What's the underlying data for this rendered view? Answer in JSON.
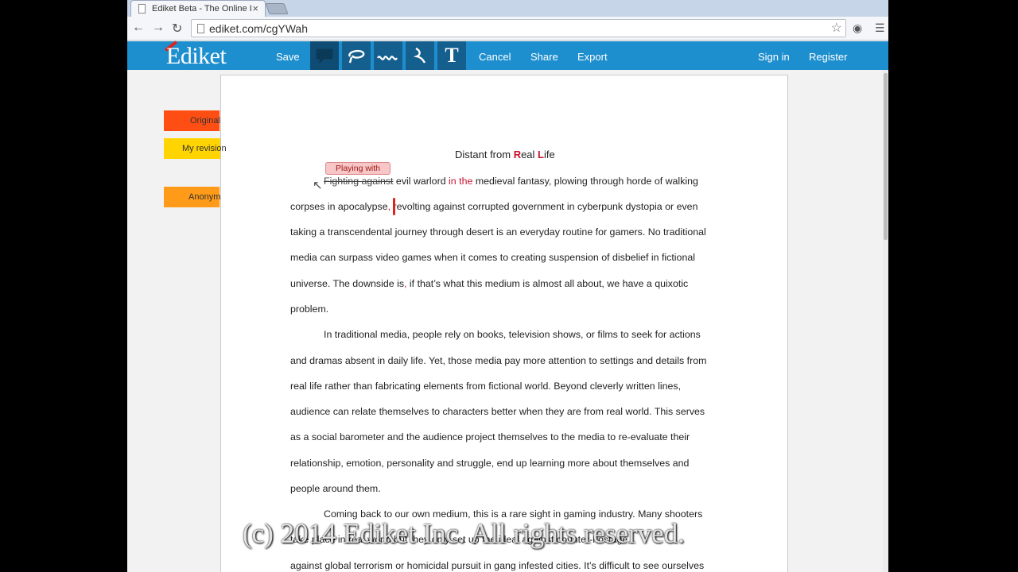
{
  "browser": {
    "tab_title": "Ediket Beta - The Online I",
    "tab_close": "×",
    "url": "ediket.com/cgYWah"
  },
  "app": {
    "logo": "Ediket",
    "nav": {
      "save": "Save",
      "cancel": "Cancel",
      "share": "Share",
      "export": "Export",
      "sign_in": "Sign in",
      "register": "Register"
    },
    "tools": [
      "comment-icon",
      "lasso-icon",
      "squiggle-icon",
      "insert-icon",
      "text-icon"
    ],
    "tool_text_label": "T"
  },
  "revisions": {
    "original": "Original",
    "mine": "My revision",
    "anonymous": "Anonym"
  },
  "document": {
    "title_prefix": "Distant from ",
    "title_R": "R",
    "title_mid": "eal ",
    "title_L": "L",
    "title_end": "ife",
    "comment": "Playing with",
    "l1_del": "Fighting against",
    "l1_a": " evil warlord ",
    "l1_ins_in": "in",
    "l1_b": " ",
    "l1_ins_the": "the",
    "l1_c": " medieval fantasy, plowing through horde of walking",
    "l2_a": "corpses in apocalypse",
    "l2_ins": ",",
    "l2_b": " revolting against corrupted government in cyberpunk dystopia or even",
    "l3": "taking a transcendental journey through desert is an everyday routine for gamers. No traditional",
    "l4": "media can surpass video games when it comes to creating suspension of disbelief in fictional",
    "l5_a": "universe. The downside is",
    "l5_ins": ",",
    "l5_b": " if that’s what this medium is almost all about, we have a quixotic",
    "l6": "problem.",
    "l7": "In traditional media, people rely on books, television shows, or films to seek for actions",
    "l8": "and dramas absent in daily life. Yet, those media pay more attention to settings and details from",
    "l9": "real life rather than fabricating elements from fictional world. Beyond cleverly written lines,",
    "l10": "audience can relate themselves to characters better when they are from real world. This serves",
    "l11": "as a social barometer and the audience project themselves to the media to re-evaluate their",
    "l12": "relationship, emotion, personality and struggle, end up learning more about themselves and",
    "l13": "people around them.",
    "l14": "Coming back to our own medium, this is a rare sight in gaming industry. Many shooters",
    "l15": "take place in real world but they only set up the ideal against counter-hostage,",
    "l16": "against global terrorism or homicidal pursuit in gang infested cities. It’s difficult to see ourselves"
  },
  "watermark": "(c) 2014 Ediket Inc. All rights reserved."
}
